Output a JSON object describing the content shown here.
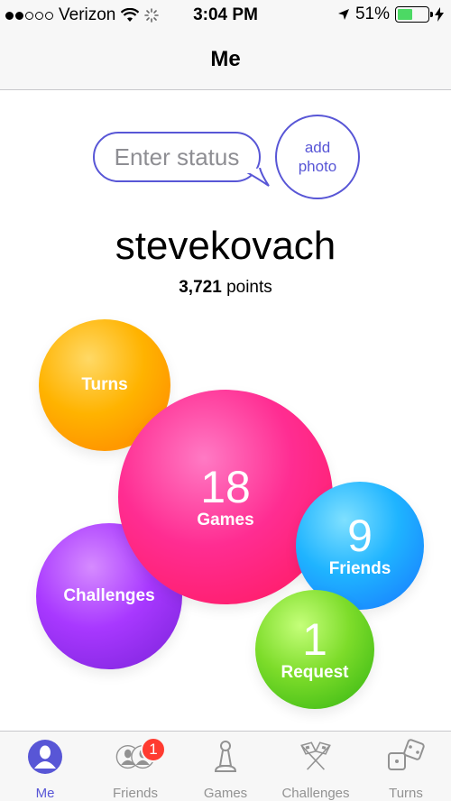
{
  "status_bar": {
    "carrier": "Verizon",
    "time": "3:04 PM",
    "battery": "51%",
    "battery_level": 0.51,
    "signal_bars": 2
  },
  "nav": {
    "title": "Me"
  },
  "profile": {
    "status_placeholder": "Enter status",
    "add_photo_line1": "add",
    "add_photo_line2": "photo",
    "username": "stevekovach",
    "points_value": "3,721",
    "points_label": "points"
  },
  "bubbles": {
    "turns": {
      "label": "Turns"
    },
    "games": {
      "count": "18",
      "label": "Games"
    },
    "challenges": {
      "label": "Challenges"
    },
    "friends": {
      "count": "9",
      "label": "Friends"
    },
    "request": {
      "count": "1",
      "label": "Request"
    }
  },
  "tabs": [
    {
      "label": "Me",
      "icon": "person-icon",
      "active": true
    },
    {
      "label": "Friends",
      "icon": "friends-icon",
      "badge": "1"
    },
    {
      "label": "Games",
      "icon": "pawn-icon"
    },
    {
      "label": "Challenges",
      "icon": "crossed-flags-icon"
    },
    {
      "label": "Turns",
      "icon": "dice-icon"
    }
  ],
  "colors": {
    "accent": "#5856d6",
    "badge": "#ff3b30",
    "battery": "#4cd964"
  }
}
